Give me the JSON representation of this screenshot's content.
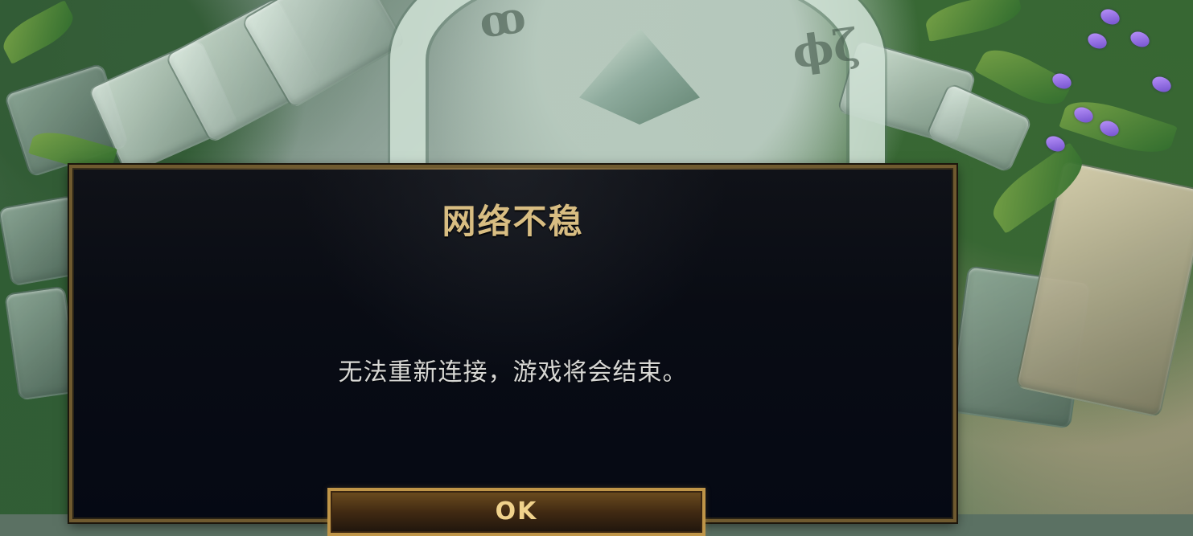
{
  "dialog": {
    "title": "网络不稳",
    "message": "无法重新连接，游戏将会结束。",
    "button_label": "OK"
  },
  "colors": {
    "panel_background": "#090c14",
    "panel_border": "#6f5a2f",
    "title_gold": "#d8bd82",
    "message_text": "#d7d7d4",
    "button_gold": "#bf9548",
    "button_text": "#f0d28c"
  },
  "icons": {
    "background": "stone-garden-scene"
  }
}
